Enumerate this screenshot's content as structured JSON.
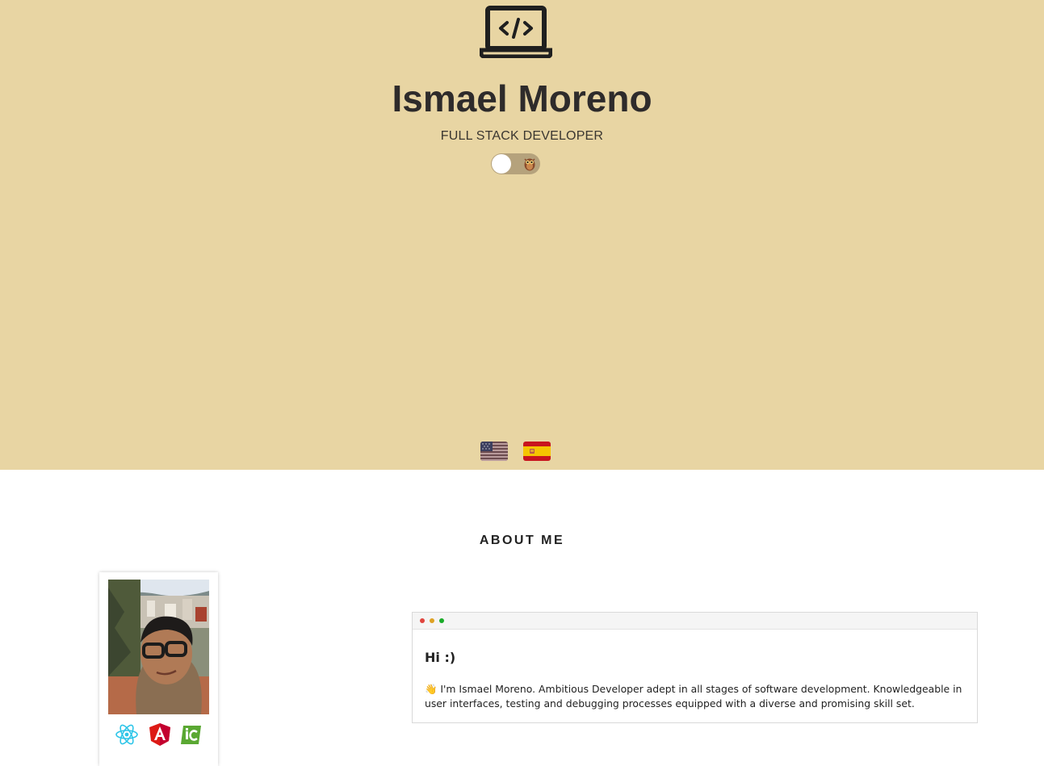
{
  "hero": {
    "icon": "laptop-code-icon",
    "name": "Ismael Moreno",
    "role": "FULL STACK DEVELOPER",
    "background_color": "#e8d5a3",
    "theme_toggle": {
      "icon": "owl-icon",
      "state": "off"
    },
    "languages": [
      {
        "icon": "us-flag-icon",
        "code": "en"
      },
      {
        "icon": "spain-flag-icon",
        "code": "es"
      }
    ]
  },
  "about": {
    "title": "ABOUT ME",
    "photo_icon": "profile-photo",
    "tech_icons": [
      "react-icon",
      "angular-icon",
      "ionic-icon"
    ],
    "card": {
      "heading": "Hi :)",
      "body": "👋 I'm Ismael Moreno. Ambitious Developer adept in all stages of software development. Knowledgeable in user interfaces, testing and debugging processes equipped with a diverse and promising skill set.",
      "window_dots": [
        "#e0443e",
        "#dea123",
        "#1aab29"
      ]
    }
  }
}
